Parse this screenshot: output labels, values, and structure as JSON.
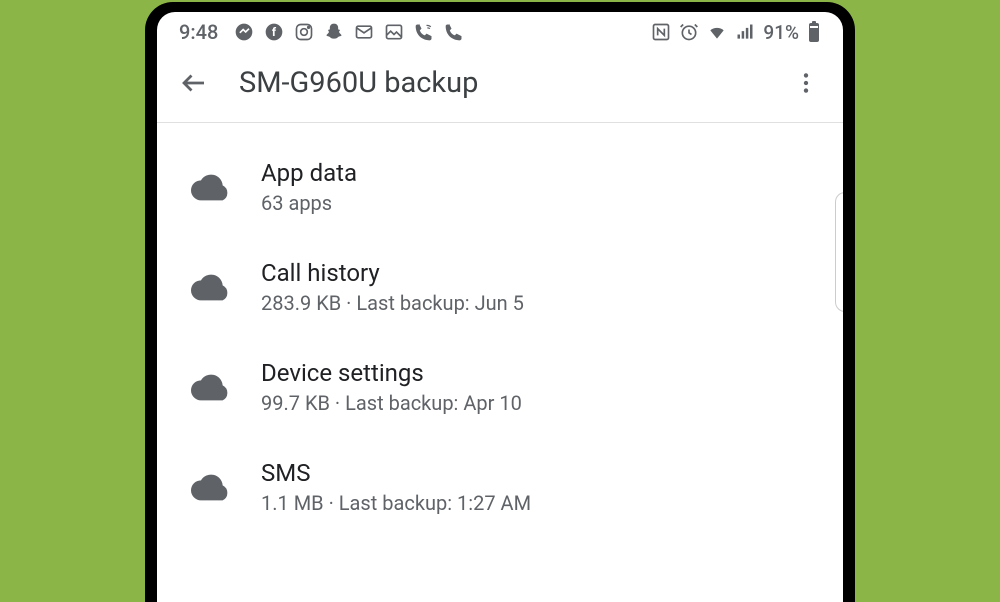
{
  "status": {
    "time": "9:48",
    "battery_pct": "91%"
  },
  "header": {
    "title": "SM-G960U backup"
  },
  "items": [
    {
      "title": "App data",
      "subtitle": "63 apps"
    },
    {
      "title": "Call history",
      "subtitle": "283.9 KB · Last backup: Jun 5"
    },
    {
      "title": "Device settings",
      "subtitle": "99.7 KB · Last backup: Apr 10"
    },
    {
      "title": "SMS",
      "subtitle": "1.1 MB · Last backup: 1:27 AM"
    }
  ]
}
